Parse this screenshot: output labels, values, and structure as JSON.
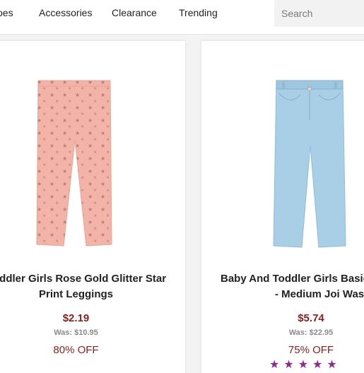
{
  "nav": {
    "items": [
      "oes",
      "Accessories",
      "Clearance",
      "Trending"
    ],
    "search_placeholder": "Search"
  },
  "products": [
    {
      "name_line1": "oddler Girls Rose Gold Glitter Star",
      "name_line2": "Print Leggings",
      "price": "$2.19",
      "was": "Was: $10.95",
      "off": "80% OFF"
    },
    {
      "name_line1": "Baby And Toddler Girls Basic J",
      "name_line2": "- Medium Joi Wash",
      "price": "$5.74",
      "was": "Was: $22.95",
      "off": "75% OFF",
      "stars": "★★★★★"
    }
  ],
  "colors": {
    "price": "#8b1e1e",
    "leggings": "#f3b3a8",
    "denim": "#a9cfe6",
    "stars": "#8e2a8c"
  }
}
